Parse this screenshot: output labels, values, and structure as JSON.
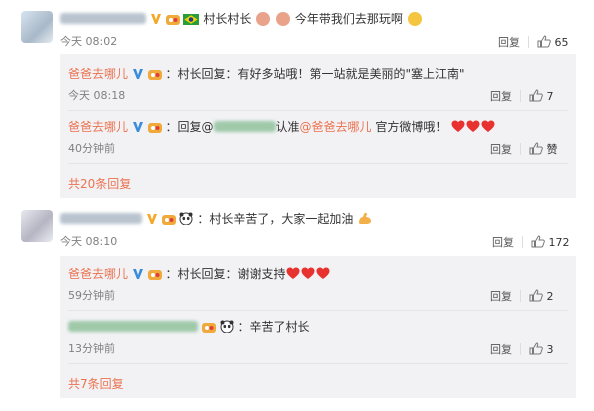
{
  "comments": [
    {
      "time": "今天 08:02",
      "reply_label": "回复",
      "like_count": "65",
      "text_a": "村长村长",
      "text_b": "今年带我们去那玩啊",
      "replies": [
        {
          "user": "爸爸去哪儿",
          "text": "：村长回复：有好多站哦！第一站就是美丽的\"塞上江南\"",
          "time": "今天 08:18",
          "reply_label": "回复",
          "like_count": "7"
        },
        {
          "user": "爸爸去哪儿",
          "text_a": "：回复@",
          "text_b": "认准",
          "mention": "@爸爸去哪儿",
          "text_c": "官方微博哦！",
          "time": "40分钟前",
          "reply_label": "回复",
          "like_label": "赞"
        }
      ],
      "more_replies": "共20条回复"
    },
    {
      "time": "今天 08:10",
      "reply_label": "回复",
      "like_count": "172",
      "text": "：村长辛苦了，大家一起加油",
      "replies": [
        {
          "user": "爸爸去哪儿",
          "text": "：村长回复：谢谢支持",
          "time": "59分钟前",
          "reply_label": "回复",
          "like_count": "2"
        },
        {
          "text": "：辛苦了村长",
          "time": "13分钟前",
          "reply_label": "回复",
          "like_count": "3"
        }
      ],
      "more_replies": "共7条回复"
    }
  ],
  "colors": {
    "link": "#eb7350",
    "reply_bg": "#f2f2f5",
    "heart": "#e8322f",
    "vip_v": "#f5a623"
  }
}
